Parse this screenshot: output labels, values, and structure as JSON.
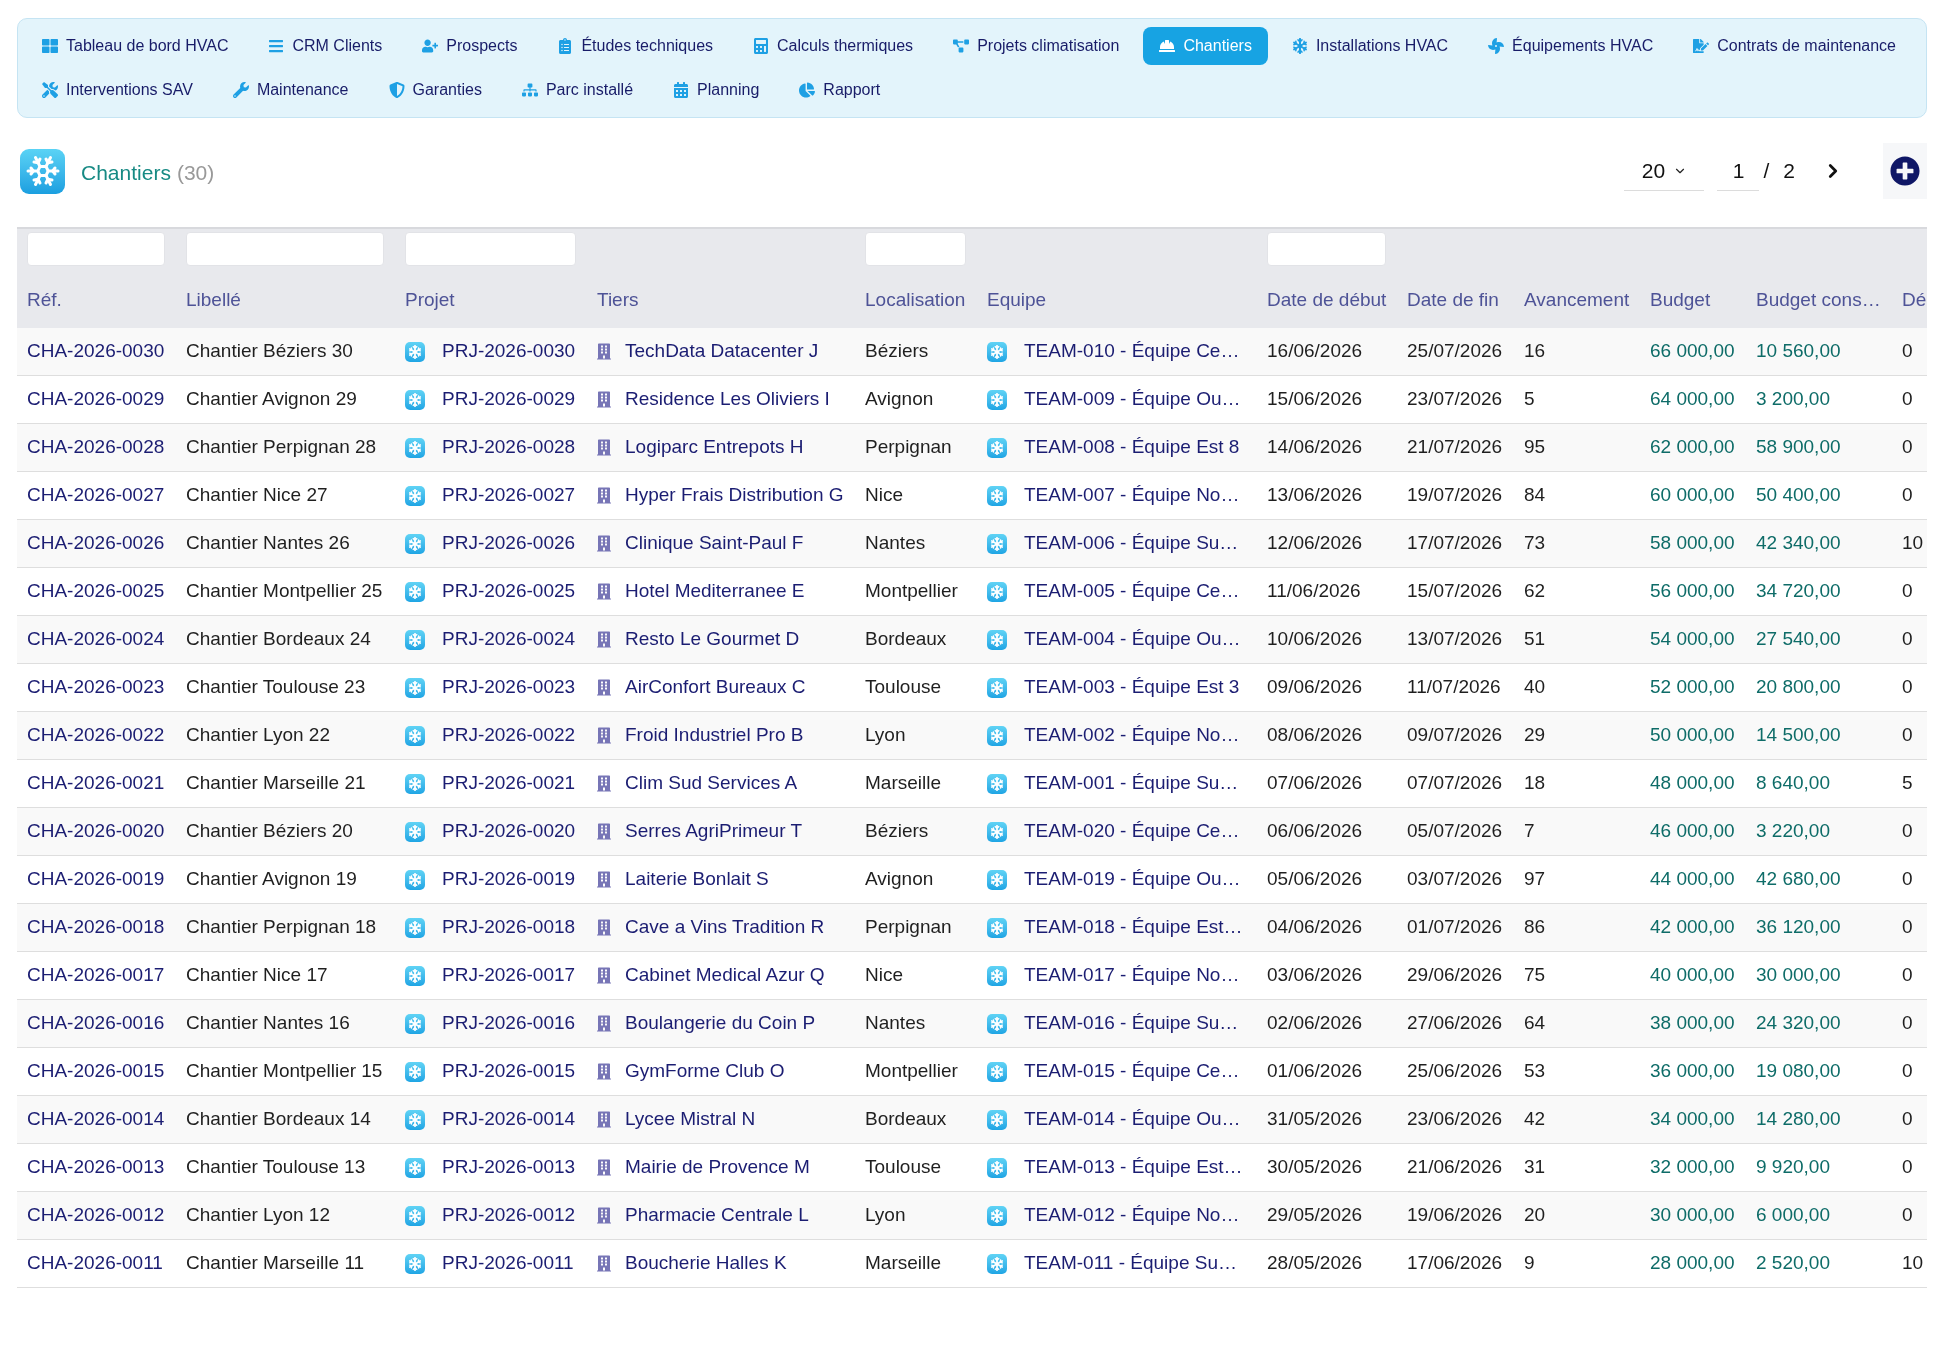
{
  "nav": {
    "items": [
      {
        "label": "Tableau de bord HVAC",
        "selected": false
      },
      {
        "label": "CRM Clients",
        "selected": false
      },
      {
        "label": "Prospects",
        "selected": false
      },
      {
        "label": "Études techniques",
        "selected": false
      },
      {
        "label": "Calculs thermiques",
        "selected": false
      },
      {
        "label": "Projets climatisation",
        "selected": false
      },
      {
        "label": "Chantiers",
        "selected": true
      },
      {
        "label": "Installations HVAC",
        "selected": false
      },
      {
        "label": "Équipements HVAC",
        "selected": false
      },
      {
        "label": "Contrats de maintenance",
        "selected": false
      },
      {
        "label": "Interventions SAV",
        "selected": false
      },
      {
        "label": "Maintenance",
        "selected": false
      },
      {
        "label": "Garanties",
        "selected": false
      },
      {
        "label": "Parc installé",
        "selected": false
      },
      {
        "label": "Planning",
        "selected": false
      },
      {
        "label": "Rapport",
        "selected": false
      }
    ]
  },
  "header": {
    "title": "Chantiers",
    "count": "(30)"
  },
  "pagination": {
    "page_size": "20",
    "page": "1",
    "separator": "/",
    "total_pages": "2"
  },
  "table": {
    "columns": [
      {
        "label": "Réf.",
        "kind": "link",
        "filter": true
      },
      {
        "label": "Libellé",
        "kind": "text",
        "filter": true
      },
      {
        "label": "Projet",
        "kind": "project",
        "filter": true
      },
      {
        "label": "Tiers",
        "kind": "company",
        "filter": false
      },
      {
        "label": "Localisation",
        "kind": "text",
        "filter": true
      },
      {
        "label": "Equipe",
        "kind": "team",
        "filter": false
      },
      {
        "label": "Date de début",
        "kind": "text",
        "filter": true
      },
      {
        "label": "Date de fin",
        "kind": "text",
        "filter": false
      },
      {
        "label": "Avancement",
        "kind": "text",
        "filter": false
      },
      {
        "label": "Budget",
        "kind": "money",
        "filter": false
      },
      {
        "label": "Budget cons…",
        "kind": "money",
        "filter": false
      },
      {
        "label": "Dé",
        "kind": "text",
        "filter": false
      }
    ],
    "rows": [
      {
        "cells": [
          "CHA-2026-0030",
          "Chantier Béziers 30",
          "PRJ-2026-0030",
          "TechData Datacenter J",
          "Béziers",
          "TEAM-010 - Équipe Ce…",
          "16/06/2026",
          "25/07/2026",
          "16",
          "66 000,00",
          "10 560,00",
          "0"
        ]
      },
      {
        "cells": [
          "CHA-2026-0029",
          "Chantier Avignon 29",
          "PRJ-2026-0029",
          "Residence Les Oliviers I",
          "Avignon",
          "TEAM-009 - Équipe Ou…",
          "15/06/2026",
          "23/07/2026",
          "5",
          "64 000,00",
          "3 200,00",
          "0"
        ]
      },
      {
        "cells": [
          "CHA-2026-0028",
          "Chantier Perpignan 28",
          "PRJ-2026-0028",
          "Logiparc Entrepots H",
          "Perpignan",
          "TEAM-008 - Équipe Est 8",
          "14/06/2026",
          "21/07/2026",
          "95",
          "62 000,00",
          "58 900,00",
          "0"
        ]
      },
      {
        "cells": [
          "CHA-2026-0027",
          "Chantier Nice 27",
          "PRJ-2026-0027",
          "Hyper Frais Distribution G",
          "Nice",
          "TEAM-007 - Équipe No…",
          "13/06/2026",
          "19/07/2026",
          "84",
          "60 000,00",
          "50 400,00",
          "0"
        ]
      },
      {
        "cells": [
          "CHA-2026-0026",
          "Chantier Nantes 26",
          "PRJ-2026-0026",
          "Clinique Saint-Paul F",
          "Nantes",
          "TEAM-006 - Équipe Su…",
          "12/06/2026",
          "17/07/2026",
          "73",
          "58 000,00",
          "42 340,00",
          "10"
        ]
      },
      {
        "cells": [
          "CHA-2026-0025",
          "Chantier Montpellier 25",
          "PRJ-2026-0025",
          "Hotel Mediterranee E",
          "Montpellier",
          "TEAM-005 - Équipe Ce…",
          "11/06/2026",
          "15/07/2026",
          "62",
          "56 000,00",
          "34 720,00",
          "0"
        ]
      },
      {
        "cells": [
          "CHA-2026-0024",
          "Chantier Bordeaux 24",
          "PRJ-2026-0024",
          "Resto Le Gourmet D",
          "Bordeaux",
          "TEAM-004 - Équipe Ou…",
          "10/06/2026",
          "13/07/2026",
          "51",
          "54 000,00",
          "27 540,00",
          "0"
        ]
      },
      {
        "cells": [
          "CHA-2026-0023",
          "Chantier Toulouse 23",
          "PRJ-2026-0023",
          "AirConfort Bureaux C",
          "Toulouse",
          "TEAM-003 - Équipe Est 3",
          "09/06/2026",
          "11/07/2026",
          "40",
          "52 000,00",
          "20 800,00",
          "0"
        ]
      },
      {
        "cells": [
          "CHA-2026-0022",
          "Chantier Lyon 22",
          "PRJ-2026-0022",
          "Froid Industriel Pro B",
          "Lyon",
          "TEAM-002 - Équipe No…",
          "08/06/2026",
          "09/07/2026",
          "29",
          "50 000,00",
          "14 500,00",
          "0"
        ]
      },
      {
        "cells": [
          "CHA-2026-0021",
          "Chantier Marseille 21",
          "PRJ-2026-0021",
          "Clim Sud Services A",
          "Marseille",
          "TEAM-001 - Équipe Su…",
          "07/06/2026",
          "07/07/2026",
          "18",
          "48 000,00",
          "8 640,00",
          "5"
        ]
      },
      {
        "cells": [
          "CHA-2026-0020",
          "Chantier Béziers 20",
          "PRJ-2026-0020",
          "Serres AgriPrimeur T",
          "Béziers",
          "TEAM-020 - Équipe Ce…",
          "06/06/2026",
          "05/07/2026",
          "7",
          "46 000,00",
          "3 220,00",
          "0"
        ]
      },
      {
        "cells": [
          "CHA-2026-0019",
          "Chantier Avignon 19",
          "PRJ-2026-0019",
          "Laiterie Bonlait S",
          "Avignon",
          "TEAM-019 - Équipe Ou…",
          "05/06/2026",
          "03/07/2026",
          "97",
          "44 000,00",
          "42 680,00",
          "0"
        ]
      },
      {
        "cells": [
          "CHA-2026-0018",
          "Chantier Perpignan 18",
          "PRJ-2026-0018",
          "Cave a Vins Tradition R",
          "Perpignan",
          "TEAM-018 - Équipe Est…",
          "04/06/2026",
          "01/07/2026",
          "86",
          "42 000,00",
          "36 120,00",
          "0"
        ]
      },
      {
        "cells": [
          "CHA-2026-0017",
          "Chantier Nice 17",
          "PRJ-2026-0017",
          "Cabinet Medical Azur Q",
          "Nice",
          "TEAM-017 - Équipe No…",
          "03/06/2026",
          "29/06/2026",
          "75",
          "40 000,00",
          "30 000,00",
          "0"
        ]
      },
      {
        "cells": [
          "CHA-2026-0016",
          "Chantier Nantes 16",
          "PRJ-2026-0016",
          "Boulangerie du Coin P",
          "Nantes",
          "TEAM-016 - Équipe Su…",
          "02/06/2026",
          "27/06/2026",
          "64",
          "38 000,00",
          "24 320,00",
          "0"
        ]
      },
      {
        "cells": [
          "CHA-2026-0015",
          "Chantier Montpellier 15",
          "PRJ-2026-0015",
          "GymForme Club O",
          "Montpellier",
          "TEAM-015 - Équipe Ce…",
          "01/06/2026",
          "25/06/2026",
          "53",
          "36 000,00",
          "19 080,00",
          "0"
        ]
      },
      {
        "cells": [
          "CHA-2026-0014",
          "Chantier Bordeaux 14",
          "PRJ-2026-0014",
          "Lycee Mistral N",
          "Bordeaux",
          "TEAM-014 - Équipe Ou…",
          "31/05/2026",
          "23/06/2026",
          "42",
          "34 000,00",
          "14 280,00",
          "0"
        ]
      },
      {
        "cells": [
          "CHA-2026-0013",
          "Chantier Toulouse 13",
          "PRJ-2026-0013",
          "Mairie de Provence M",
          "Toulouse",
          "TEAM-013 - Équipe Est…",
          "30/05/2026",
          "21/06/2026",
          "31",
          "32 000,00",
          "9 920,00",
          "0"
        ]
      },
      {
        "cells": [
          "CHA-2026-0012",
          "Chantier Lyon 12",
          "PRJ-2026-0012",
          "Pharmacie Centrale L",
          "Lyon",
          "TEAM-012 - Équipe No…",
          "29/05/2026",
          "19/06/2026",
          "20",
          "30 000,00",
          "6 000,00",
          "0"
        ]
      },
      {
        "cells": [
          "CHA-2026-0011",
          "Chantier Marseille 11",
          "PRJ-2026-0011",
          "Boucherie Halles K",
          "Marseille",
          "TEAM-011 - Équipe Su…",
          "28/05/2026",
          "17/06/2026",
          "9",
          "28 000,00",
          "2 520,00",
          "10"
        ]
      }
    ]
  }
}
